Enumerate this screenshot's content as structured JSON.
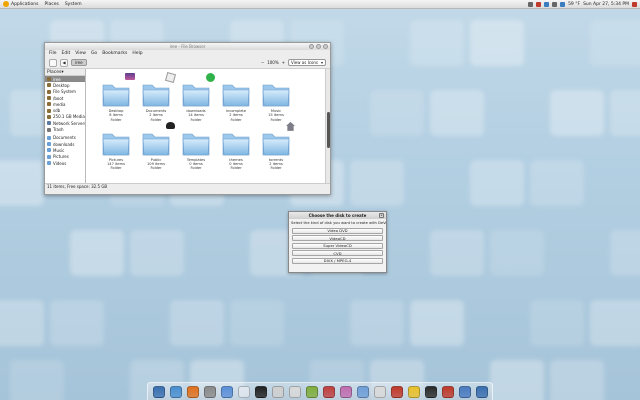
{
  "top_panel": {
    "menus": [
      "Applications",
      "Places",
      "System"
    ],
    "clock": "Sun Apr 27,  5:34 PM",
    "temperature": "59 °F"
  },
  "nautilus": {
    "title": "iree - File Browser",
    "menu": [
      "File",
      "Edit",
      "View",
      "Go",
      "Bookmarks",
      "Help"
    ],
    "breadcrumb": "iree",
    "zoom_level": "100%",
    "view_mode": "View as Icons",
    "places_label": "Places",
    "sidebar": [
      {
        "label": "iree",
        "kind": "home",
        "selected": true
      },
      {
        "label": "Desktop",
        "kind": "home"
      },
      {
        "label": "File System",
        "kind": "home"
      },
      {
        "label": "/boot",
        "kind": "home"
      },
      {
        "label": "media",
        "kind": "home"
      },
      {
        "label": "sdb",
        "kind": "home"
      },
      {
        "label": "250.1 GB Media",
        "kind": "home"
      },
      {
        "label": "Network Servers",
        "kind": "net"
      },
      {
        "label": "Trash",
        "kind": "trash"
      },
      {
        "label": "Documents",
        "kind": "folder"
      },
      {
        "label": "downloads",
        "kind": "folder"
      },
      {
        "label": "Music",
        "kind": "folder"
      },
      {
        "label": "Pictures",
        "kind": "folder"
      },
      {
        "label": "Videos",
        "kind": "folder"
      }
    ],
    "items": [
      {
        "name": "Desktop",
        "count": "8 items",
        "type": "Folder",
        "emblem": "desktop"
      },
      {
        "name": "Documents",
        "count": "2 items",
        "type": "Folder",
        "emblem": "documents"
      },
      {
        "name": "downloads",
        "count": "14 items",
        "type": "Folder",
        "emblem": "downloads"
      },
      {
        "name": "incomplete",
        "count": "2 items",
        "type": "Folder",
        "emblem": ""
      },
      {
        "name": "Music",
        "count": "15 items",
        "type": "Folder",
        "emblem": ""
      },
      {
        "name": "Pictures",
        "count": "147 items",
        "type": "Folder",
        "emblem": ""
      },
      {
        "name": "Public",
        "count": "109 items",
        "type": "Folder",
        "emblem": "public"
      },
      {
        "name": "Templates",
        "count": "0 items",
        "type": "Folder",
        "emblem": ""
      },
      {
        "name": "themes",
        "count": "0 items",
        "type": "Folder",
        "emblem": ""
      },
      {
        "name": "torrents",
        "count": "2 items",
        "type": "Folder",
        "emblem": "torrents"
      }
    ],
    "status": "11 items, Free space: 32.5 GB",
    "scroll_position": 0.55
  },
  "disk_dialog": {
    "title": "Choose the disk to create",
    "prompt": "Select the kind of disk you want to create with DeVeDe",
    "options": [
      "Video DVD",
      "VideoCD",
      "Super VideoCD",
      "CVD",
      "DIVX / MPEG-4"
    ]
  },
  "dock": {
    "icons": [
      {
        "name": "xfce-icon",
        "color": "#3a6fb0"
      },
      {
        "name": "network-icon",
        "color": "#4a8fd0"
      },
      {
        "name": "firefox-icon",
        "color": "#e0701e"
      },
      {
        "name": "usb-drive-icon",
        "color": "#8a8a8a"
      },
      {
        "name": "music-icon",
        "color": "#5b8fd8"
      },
      {
        "name": "calendar-icon",
        "color": "#dfe6ee"
      },
      {
        "name": "terminal-icon",
        "color": "#222222"
      },
      {
        "name": "printer-icon",
        "color": "#cfcfcf"
      },
      {
        "name": "chat-icon",
        "color": "#d9d9d9"
      },
      {
        "name": "text-editor-icon",
        "color": "#7fae3e"
      },
      {
        "name": "chart-icon",
        "color": "#c04040"
      },
      {
        "name": "pidgin-icon",
        "color": "#c06fb0"
      },
      {
        "name": "globe-icon",
        "color": "#6f9fd8"
      },
      {
        "name": "devede-icon",
        "color": "#d9d9d9"
      },
      {
        "name": "media-player-icon",
        "color": "#c0392b"
      },
      {
        "name": "radiation-icon",
        "color": "#e8c02a"
      },
      {
        "name": "monitor-icon",
        "color": "#2a2a2a"
      },
      {
        "name": "paint-icon",
        "color": "#c0392b"
      },
      {
        "name": "tool-icon",
        "color": "#4a7bc0"
      },
      {
        "name": "trash-icon",
        "color": "#3a6fb0"
      }
    ]
  }
}
